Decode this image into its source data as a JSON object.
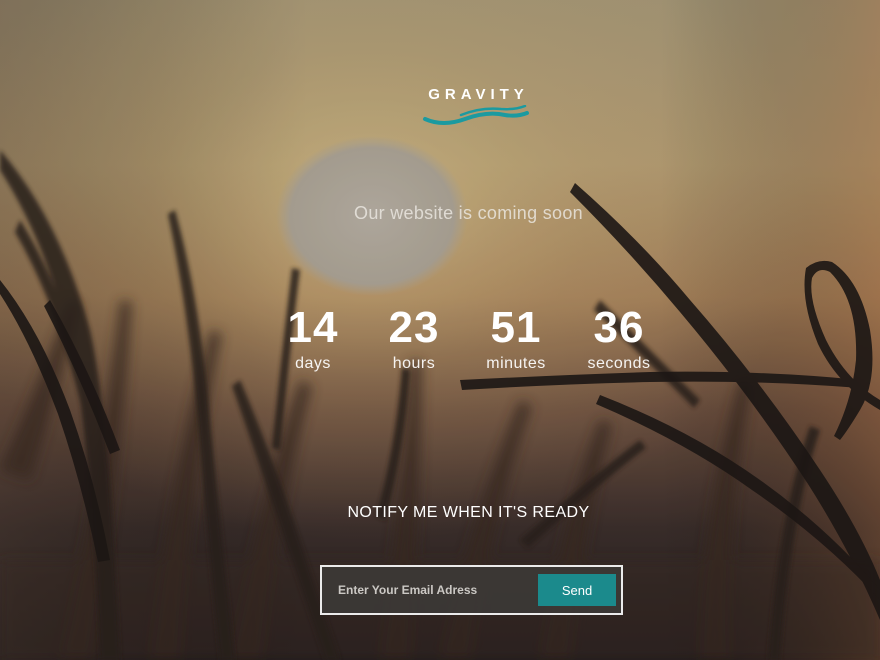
{
  "brand": {
    "name": "GRAVITY",
    "wave_color": "#1b9aa0"
  },
  "tagline": "Our website is coming soon",
  "countdown": {
    "days": {
      "value": "14",
      "label": "days"
    },
    "hours": {
      "value": "23",
      "label": "hours"
    },
    "minutes": {
      "value": "51",
      "label": "minutes"
    },
    "seconds": {
      "value": "36",
      "label": "seconds"
    }
  },
  "notify": {
    "heading": "NOTIFY ME WHEN IT'S READY",
    "email_placeholder": "Enter Your Email Adress",
    "send_label": "Send"
  },
  "colors": {
    "accent": "#1b8a8c",
    "form_background": "#3c3836"
  }
}
